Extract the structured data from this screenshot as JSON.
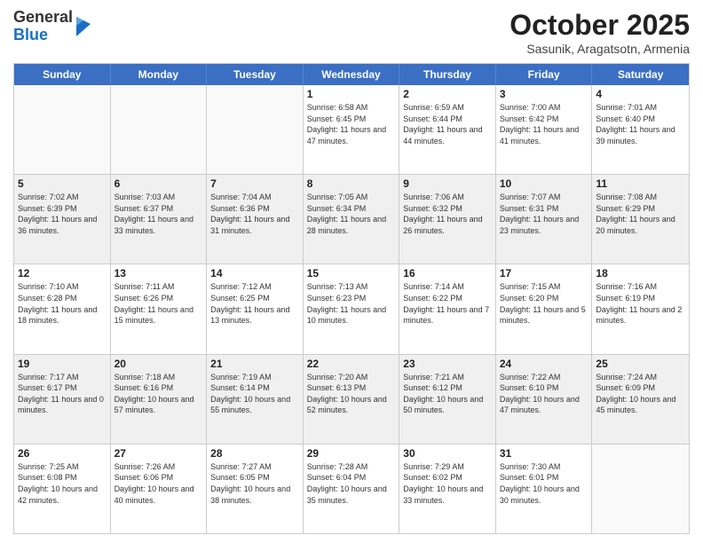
{
  "logo": {
    "general": "General",
    "blue": "Blue"
  },
  "title": "October 2025",
  "location": "Sasunik, Aragatsotn, Armenia",
  "days_of_week": [
    "Sunday",
    "Monday",
    "Tuesday",
    "Wednesday",
    "Thursday",
    "Friday",
    "Saturday"
  ],
  "weeks": [
    [
      {
        "num": "",
        "info": "",
        "empty": true
      },
      {
        "num": "",
        "info": "",
        "empty": true
      },
      {
        "num": "",
        "info": "",
        "empty": true
      },
      {
        "num": "1",
        "info": "Sunrise: 6:58 AM\nSunset: 6:45 PM\nDaylight: 11 hours and 47 minutes.",
        "empty": false
      },
      {
        "num": "2",
        "info": "Sunrise: 6:59 AM\nSunset: 6:44 PM\nDaylight: 11 hours and 44 minutes.",
        "empty": false
      },
      {
        "num": "3",
        "info": "Sunrise: 7:00 AM\nSunset: 6:42 PM\nDaylight: 11 hours and 41 minutes.",
        "empty": false
      },
      {
        "num": "4",
        "info": "Sunrise: 7:01 AM\nSunset: 6:40 PM\nDaylight: 11 hours and 39 minutes.",
        "empty": false
      }
    ],
    [
      {
        "num": "5",
        "info": "Sunrise: 7:02 AM\nSunset: 6:39 PM\nDaylight: 11 hours and 36 minutes.",
        "empty": false
      },
      {
        "num": "6",
        "info": "Sunrise: 7:03 AM\nSunset: 6:37 PM\nDaylight: 11 hours and 33 minutes.",
        "empty": false
      },
      {
        "num": "7",
        "info": "Sunrise: 7:04 AM\nSunset: 6:36 PM\nDaylight: 11 hours and 31 minutes.",
        "empty": false
      },
      {
        "num": "8",
        "info": "Sunrise: 7:05 AM\nSunset: 6:34 PM\nDaylight: 11 hours and 28 minutes.",
        "empty": false
      },
      {
        "num": "9",
        "info": "Sunrise: 7:06 AM\nSunset: 6:32 PM\nDaylight: 11 hours and 26 minutes.",
        "empty": false
      },
      {
        "num": "10",
        "info": "Sunrise: 7:07 AM\nSunset: 6:31 PM\nDaylight: 11 hours and 23 minutes.",
        "empty": false
      },
      {
        "num": "11",
        "info": "Sunrise: 7:08 AM\nSunset: 6:29 PM\nDaylight: 11 hours and 20 minutes.",
        "empty": false
      }
    ],
    [
      {
        "num": "12",
        "info": "Sunrise: 7:10 AM\nSunset: 6:28 PM\nDaylight: 11 hours and 18 minutes.",
        "empty": false
      },
      {
        "num": "13",
        "info": "Sunrise: 7:11 AM\nSunset: 6:26 PM\nDaylight: 11 hours and 15 minutes.",
        "empty": false
      },
      {
        "num": "14",
        "info": "Sunrise: 7:12 AM\nSunset: 6:25 PM\nDaylight: 11 hours and 13 minutes.",
        "empty": false
      },
      {
        "num": "15",
        "info": "Sunrise: 7:13 AM\nSunset: 6:23 PM\nDaylight: 11 hours and 10 minutes.",
        "empty": false
      },
      {
        "num": "16",
        "info": "Sunrise: 7:14 AM\nSunset: 6:22 PM\nDaylight: 11 hours and 7 minutes.",
        "empty": false
      },
      {
        "num": "17",
        "info": "Sunrise: 7:15 AM\nSunset: 6:20 PM\nDaylight: 11 hours and 5 minutes.",
        "empty": false
      },
      {
        "num": "18",
        "info": "Sunrise: 7:16 AM\nSunset: 6:19 PM\nDaylight: 11 hours and 2 minutes.",
        "empty": false
      }
    ],
    [
      {
        "num": "19",
        "info": "Sunrise: 7:17 AM\nSunset: 6:17 PM\nDaylight: 11 hours and 0 minutes.",
        "empty": false
      },
      {
        "num": "20",
        "info": "Sunrise: 7:18 AM\nSunset: 6:16 PM\nDaylight: 10 hours and 57 minutes.",
        "empty": false
      },
      {
        "num": "21",
        "info": "Sunrise: 7:19 AM\nSunset: 6:14 PM\nDaylight: 10 hours and 55 minutes.",
        "empty": false
      },
      {
        "num": "22",
        "info": "Sunrise: 7:20 AM\nSunset: 6:13 PM\nDaylight: 10 hours and 52 minutes.",
        "empty": false
      },
      {
        "num": "23",
        "info": "Sunrise: 7:21 AM\nSunset: 6:12 PM\nDaylight: 10 hours and 50 minutes.",
        "empty": false
      },
      {
        "num": "24",
        "info": "Sunrise: 7:22 AM\nSunset: 6:10 PM\nDaylight: 10 hours and 47 minutes.",
        "empty": false
      },
      {
        "num": "25",
        "info": "Sunrise: 7:24 AM\nSunset: 6:09 PM\nDaylight: 10 hours and 45 minutes.",
        "empty": false
      }
    ],
    [
      {
        "num": "26",
        "info": "Sunrise: 7:25 AM\nSunset: 6:08 PM\nDaylight: 10 hours and 42 minutes.",
        "empty": false
      },
      {
        "num": "27",
        "info": "Sunrise: 7:26 AM\nSunset: 6:06 PM\nDaylight: 10 hours and 40 minutes.",
        "empty": false
      },
      {
        "num": "28",
        "info": "Sunrise: 7:27 AM\nSunset: 6:05 PM\nDaylight: 10 hours and 38 minutes.",
        "empty": false
      },
      {
        "num": "29",
        "info": "Sunrise: 7:28 AM\nSunset: 6:04 PM\nDaylight: 10 hours and 35 minutes.",
        "empty": false
      },
      {
        "num": "30",
        "info": "Sunrise: 7:29 AM\nSunset: 6:02 PM\nDaylight: 10 hours and 33 minutes.",
        "empty": false
      },
      {
        "num": "31",
        "info": "Sunrise: 7:30 AM\nSunset: 6:01 PM\nDaylight: 10 hours and 30 minutes.",
        "empty": false
      },
      {
        "num": "",
        "info": "",
        "empty": true
      }
    ]
  ]
}
